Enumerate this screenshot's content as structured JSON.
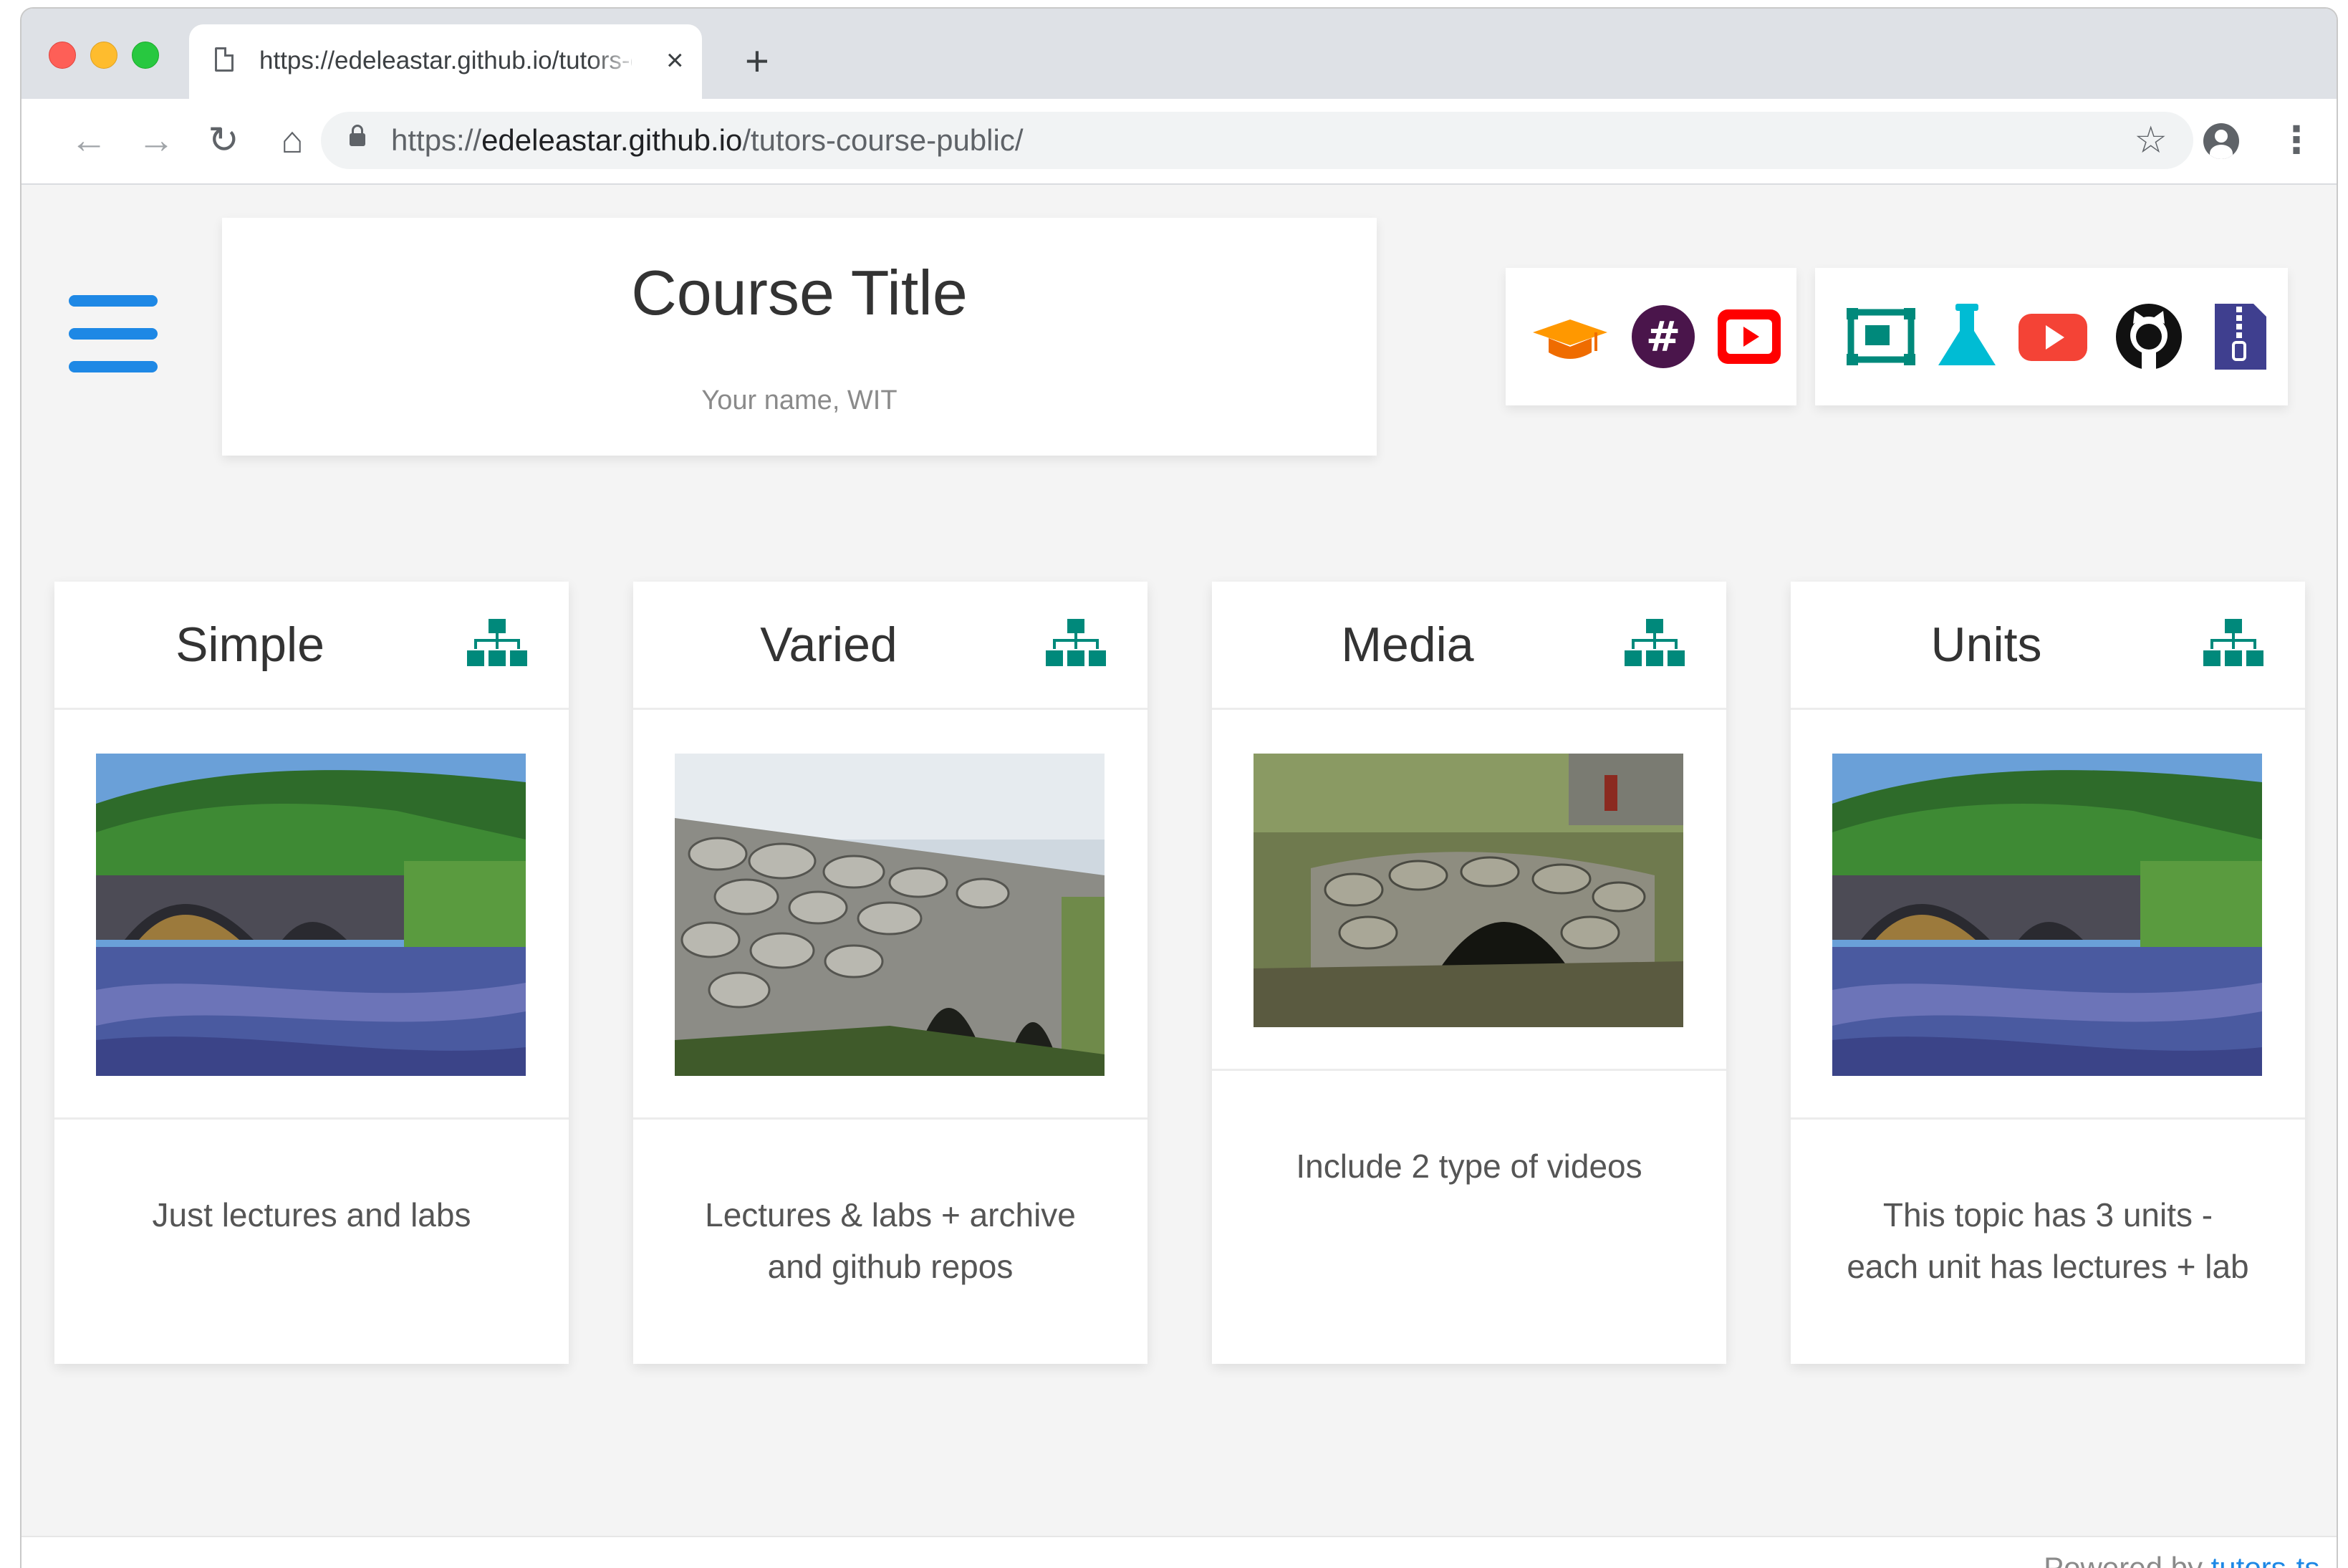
{
  "browser": {
    "tab_title": "https://edeleastar.github.io/tutors-course-public/",
    "tab_close": "×",
    "new_tab": "+",
    "url_scheme": "https://",
    "url_host": "edeleastar.github.io",
    "url_path": "/tutors-course-public/",
    "back_icon": "←",
    "forward_icon": "→",
    "reload_icon": "↻",
    "home_icon": "⌂",
    "star_icon": "☆",
    "menu_icon": "⋮"
  },
  "header": {
    "course_title": "Course Title",
    "subtitle": "Your name, WIT"
  },
  "icons": {
    "group1": [
      "moodle-graduation-cap-icon",
      "slack-icon",
      "youtube-icon"
    ],
    "group2": [
      "slides-icon",
      "lab-flask-icon",
      "youtube-icon",
      "github-icon",
      "zip-archive-icon"
    ]
  },
  "colors": {
    "accent_blue": "#1e88e5",
    "teal": "#009688",
    "orange": "#ff9800",
    "youtube_red": "#ff0000",
    "slack_purple": "#4a154b"
  },
  "topics": [
    {
      "title": "Simple",
      "desc_line1": "Just lectures and labs",
      "desc_line2": ""
    },
    {
      "title": "Varied",
      "desc_line1": "Lectures & labs + archive",
      "desc_line2": "and github repos"
    },
    {
      "title": "Media",
      "desc_line1": "Include 2 type of videos",
      "desc_line2": ""
    },
    {
      "title": "Units",
      "desc_line1": "This topic has 3 units -",
      "desc_line2": "each unit has lectures + lab"
    }
  ],
  "footer": {
    "powered_by": "Powered by",
    "link": "tutors-ts."
  }
}
